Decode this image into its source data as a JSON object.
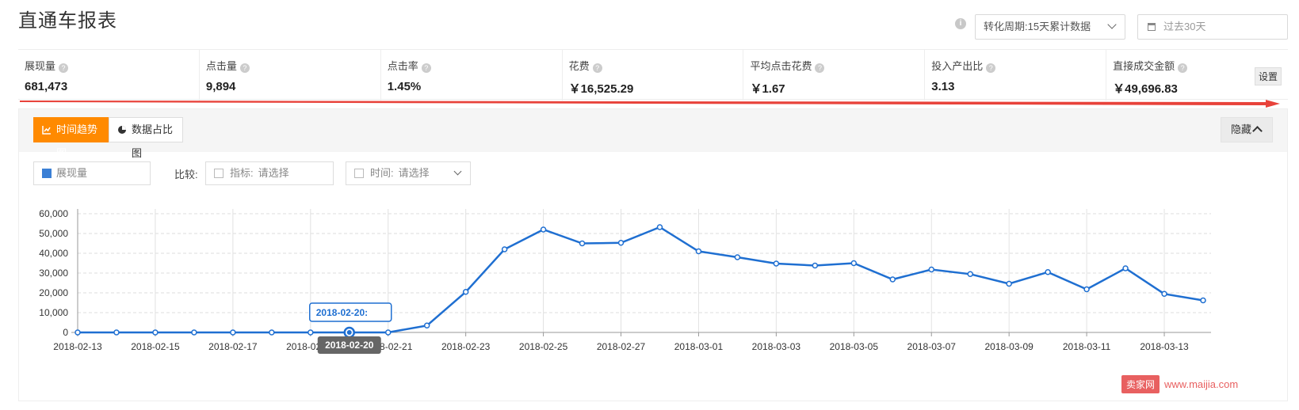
{
  "header": {
    "title": "直通车报表",
    "period_label": "转化周期:15天累计数据",
    "date_placeholder": "过去30天"
  },
  "metrics": [
    {
      "label": "展现量",
      "value": "681,473"
    },
    {
      "label": "点击量",
      "value": "9,894"
    },
    {
      "label": "点击率",
      "value": "1.45%"
    },
    {
      "label": "花费",
      "value": "￥16,525.29"
    },
    {
      "label": "平均点击花费",
      "value": "￥1.67"
    },
    {
      "label": "投入产出比",
      "value": "3.13"
    },
    {
      "label": "直接成交金额",
      "value": "￥49,696.83"
    }
  ],
  "settings_label": "设置",
  "panel": {
    "tabs": [
      {
        "label": "时间趋势图",
        "active": true
      },
      {
        "label": "数据占比图",
        "active": false
      }
    ],
    "hide_label": "隐藏",
    "metric_selected": "展现量",
    "compare_label": "比较:",
    "indicator_key": "指标:",
    "indicator_placeholder": "请选择",
    "time_key": "时间:",
    "time_placeholder": "请选择"
  },
  "colors": {
    "accent": "#ff8a00",
    "series": "#1f6fd1",
    "arrow": "#e8423a"
  },
  "chart_data": {
    "type": "line",
    "x": [
      "2018-02-13",
      "2018-02-14",
      "2018-02-15",
      "2018-02-16",
      "2018-02-17",
      "2018-02-18",
      "2018-02-19",
      "2018-02-20",
      "2018-02-21",
      "2018-02-22",
      "2018-02-23",
      "2018-02-24",
      "2018-02-25",
      "2018-02-26",
      "2018-02-27",
      "2018-02-28",
      "2018-03-01",
      "2018-03-02",
      "2018-03-03",
      "2018-03-04",
      "2018-03-05",
      "2018-03-06",
      "2018-03-07",
      "2018-03-08",
      "2018-03-09",
      "2018-03-10",
      "2018-03-11",
      "2018-03-12",
      "2018-03-13",
      "2018-03-14"
    ],
    "x_tick_labels": [
      "2018-02-13",
      "2018-02-15",
      "2018-02-17",
      "2018-02-19",
      "2018-02-21",
      "2018-02-23",
      "2018-02-25",
      "2018-02-27",
      "2018-03-01",
      "2018-03-03",
      "2018-03-05",
      "2018-03-07",
      "2018-03-09",
      "2018-03-11",
      "2018-03-13"
    ],
    "series": [
      {
        "name": "展现量",
        "values": [
          0,
          0,
          0,
          0,
          0,
          0,
          0,
          0,
          0,
          3500,
          20500,
          42000,
          52000,
          45000,
          45300,
          53200,
          41000,
          38000,
          34800,
          33800,
          35000,
          26800,
          31800,
          29500,
          24600,
          30500,
          21800,
          32400,
          19500,
          16200
        ]
      }
    ],
    "ylim": [
      0,
      60000
    ],
    "y_ticks": [
      "0",
      "10,000",
      "20,000",
      "30,000",
      "40,000",
      "50,000",
      "60,000"
    ],
    "tooltip_title": "2018-02-20:",
    "hover_label": "2018-02-20",
    "hover_index": 7,
    "grid": true
  },
  "watermark": {
    "logo": "卖家网",
    "url": "www.maijia.com"
  }
}
